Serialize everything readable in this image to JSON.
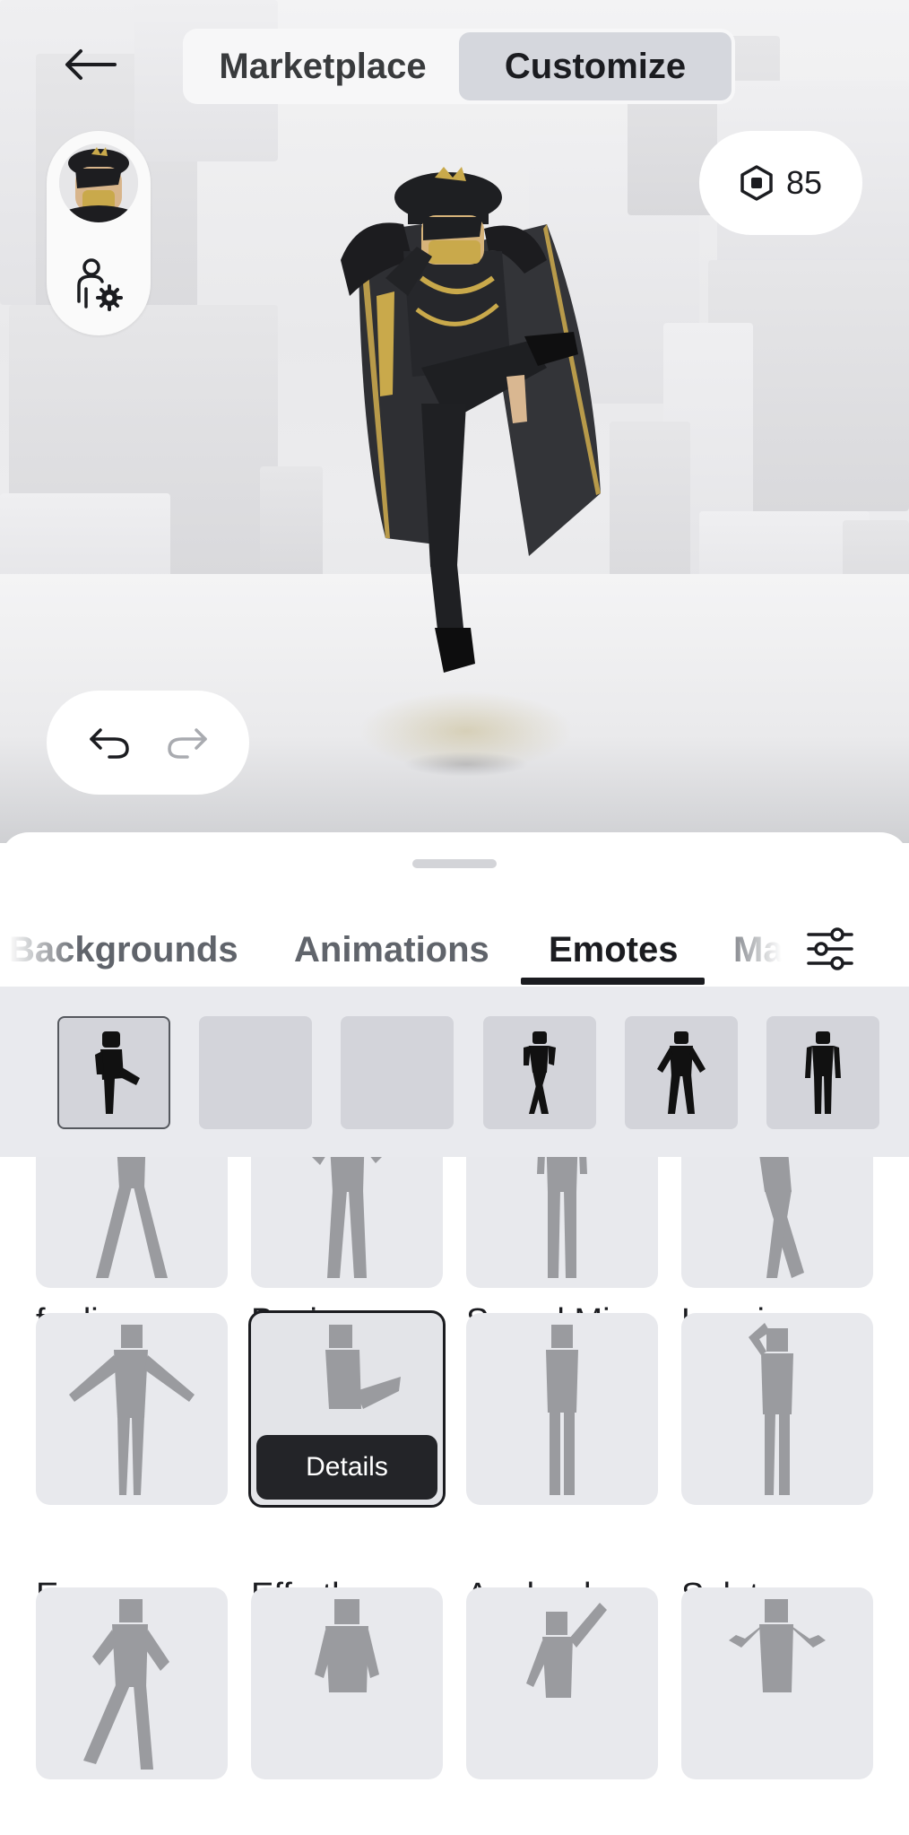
{
  "header": {
    "tabs": [
      {
        "label": "Marketplace",
        "active": false
      },
      {
        "label": "Customize",
        "active": true
      }
    ]
  },
  "robux": {
    "balance": "85"
  },
  "categories": {
    "tabs": [
      {
        "label": "Backgrounds",
        "active": false
      },
      {
        "label": "Animations",
        "active": false
      },
      {
        "label": "Emotes",
        "active": true
      },
      {
        "label": "Ma",
        "active": false
      }
    ]
  },
  "equipped_slots": [
    {
      "state": "filled",
      "selected": true
    },
    {
      "state": "empty"
    },
    {
      "state": "empty"
    },
    {
      "state": "filled"
    },
    {
      "state": "filled"
    },
    {
      "state": "filled"
    }
  ],
  "emotes": [
    {
      "label": "feelin my..."
    },
    {
      "label": "Boxing"
    },
    {
      "label": "Speed Mi..."
    },
    {
      "label": "Leaning ..."
    },
    {
      "label": "Emperor ..."
    },
    {
      "label": "Effortless",
      "selected": true,
      "action": "Details"
    },
    {
      "label": "Applaud"
    },
    {
      "label": "Salute"
    },
    {
      "label": ""
    },
    {
      "label": ""
    },
    {
      "label": ""
    },
    {
      "label": ""
    }
  ],
  "colors": {
    "accent": "#1b1c20",
    "tab_inactive": "#60646b",
    "card_bg": "#e8e9ed",
    "bar_bg": "#e9eaee"
  },
  "icons": [
    "back-arrow-icon",
    "avatar-settings-icon",
    "robux-icon",
    "undo-icon",
    "redo-icon",
    "filter-icon"
  ]
}
